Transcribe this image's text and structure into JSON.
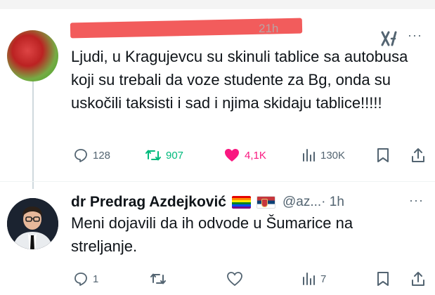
{
  "tweet1": {
    "time": "21h",
    "text": "Ljudi, u Kragujevcu su skinuli tablice sa autobusa koji su trebali da voze studente za Bg, onda su uskočili taksisti i sad i njima skidaju tablice!!!!!",
    "actions": {
      "replies": "128",
      "reposts": "907",
      "likes": "4,1K",
      "views": "130K"
    }
  },
  "tweet2": {
    "author_name": "dr Predrag Azdejković",
    "handle": "@az...",
    "time_sep": " · 1h",
    "text": "Meni dojavili da ih odvode u Šumarice na streljanje.",
    "actions": {
      "replies": "1",
      "views": "7"
    }
  },
  "icons": {
    "reply": "reply-icon",
    "repost": "repost-icon",
    "like": "heart-icon",
    "views": "views-icon",
    "bookmark": "bookmark-icon",
    "share": "share-icon",
    "grok": "grok-icon",
    "more": "more-icon"
  },
  "colors": {
    "repost_active": "#00ba7c",
    "like_active": "#f91880",
    "muted": "#536471",
    "redaction": "#f25c5c"
  }
}
